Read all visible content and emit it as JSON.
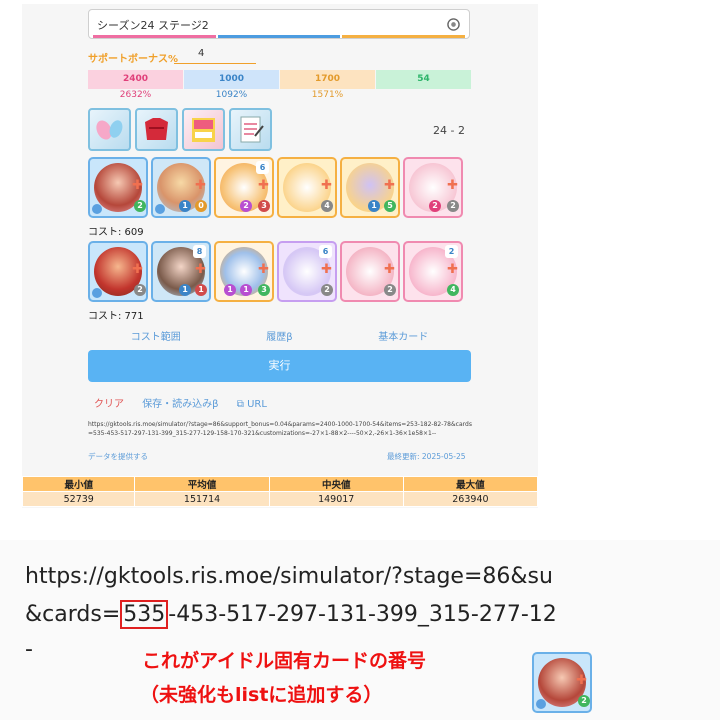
{
  "stage_select": {
    "value": "シーズン24 ステージ2",
    "bar_colors": [
      "#ef6ea2",
      "#4c9ce0",
      "#f5b042"
    ]
  },
  "support_bonus": {
    "label": "サポートボーナス%",
    "value": "4"
  },
  "params": [
    {
      "value": "2400",
      "pct": "2632%",
      "bg": "#fbd1df",
      "color": "#e0407a"
    },
    {
      "value": "1000",
      "pct": "1092%",
      "bg": "#cfe4fa",
      "color": "#3a84c7"
    },
    {
      "value": "1700",
      "pct": "1571%",
      "bg": "#fde3c0",
      "color": "#e39a2b"
    },
    {
      "value": "54",
      "pct": "",
      "bg": "#c9f2d8",
      "color": "#2eb46a"
    }
  ],
  "items": [
    {
      "icon": "nail-item-icon"
    },
    {
      "icon": "clothes-item-icon"
    },
    {
      "icon": "book-item-icon"
    },
    {
      "icon": "clipboard-item-icon"
    }
  ],
  "stage_label": "24 - 2",
  "deck1": {
    "cost": "コスト: 609",
    "cards": [
      {
        "lv": "",
        "badge": "2"
      },
      {
        "lv": "",
        "badge": "0"
      },
      {
        "lv": "6",
        "badge": "3"
      },
      {
        "lv": "",
        "badge": "4"
      },
      {
        "lv": "",
        "badge": "5"
      },
      {
        "lv": "",
        "badge": "2"
      }
    ]
  },
  "deck2": {
    "cost": "コスト: 771",
    "cards": [
      {
        "lv": "",
        "badge": "2"
      },
      {
        "lv": "8",
        "badge": "1"
      },
      {
        "lv": "",
        "badge": "3"
      },
      {
        "lv": "6",
        "badge": "2"
      },
      {
        "lv": "",
        "badge": "2"
      },
      {
        "lv": "2",
        "badge": "4"
      }
    ]
  },
  "tabs": [
    "コスト範囲",
    "履歴β",
    "基本カード"
  ],
  "run_button": "実行",
  "actions": {
    "clear": "クリア",
    "save": "保存・読み込みβ",
    "url": "URL"
  },
  "url_text": "https://gktools.ris.moe/simulator/?stage=86&support_bonus=0.04&params=2400-1000-1700-54&items=253-182-82-78&cards=535-453-517-297-131-399_315-277-129-158-170-321&customizations=-27×1-88×2----50×2,-26×1-36×1e58×1--",
  "footer": {
    "provide": "データを提供する",
    "updated": "最終更新: 2025-05-25"
  },
  "stats": {
    "headers": [
      "最小値",
      "平均値",
      "中央値",
      "最大値"
    ],
    "values": [
      "52739",
      "151714",
      "149017",
      "263940"
    ]
  },
  "zoom": {
    "line1": "https://gktools.ris.moe/simulator/?stage=86&su",
    "line2_prefix": "&cards=",
    "line2_highlight": "535",
    "line2_rest": "-453-517-297-131-399_315-277-12",
    "line3": "-",
    "note1": "これがアイドル固有カードの番号",
    "note2": "（未強化もlistに追加する）",
    "card_badge": "2"
  }
}
